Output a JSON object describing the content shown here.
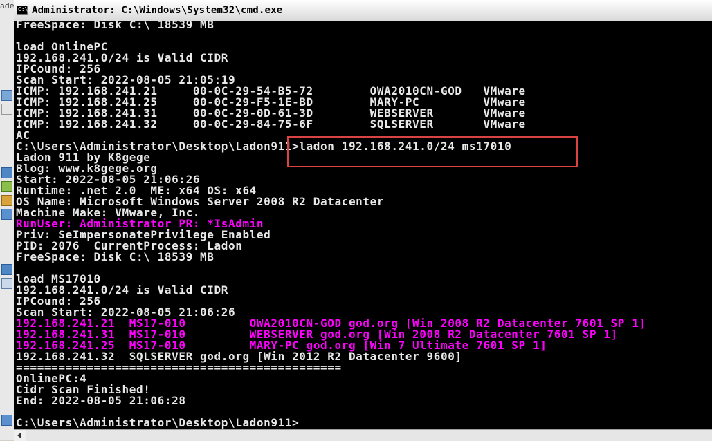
{
  "window": {
    "title": "Administrator: C:\\Windows\\System32\\cmd.exe",
    "icon": "cmd-icon",
    "icon_text": "C:\\."
  },
  "desktop": {
    "partial_text": "ade"
  },
  "console": {
    "lines": [
      {
        "text": "FreeSpace: Disk C:\\ 18539 MB",
        "color": "#e8e8e8"
      },
      {
        "text": "",
        "color": "#e8e8e8"
      },
      {
        "text": "load OnlinePC",
        "color": "#e8e8e8"
      },
      {
        "text": "192.168.241.0/24 is Valid CIDR",
        "color": "#e8e8e8"
      },
      {
        "text": "IPCound: 256",
        "color": "#e8e8e8"
      },
      {
        "text": "Scan Start: 2022-08-05 21:05:19",
        "color": "#e8e8e8"
      },
      {
        "text": "ICMP: 192.168.241.21     00-0C-29-54-B5-72        OWA2010CN-GOD   VMware",
        "color": "#e8e8e8"
      },
      {
        "text": "ICMP: 192.168.241.25     00-0C-29-F5-1E-BD        MARY-PC         VMware",
        "color": "#e8e8e8"
      },
      {
        "text": "ICMP: 192.168.241.31     00-0C-29-0D-61-3D        WEBSERVER       VMware",
        "color": "#e8e8e8"
      },
      {
        "text": "ICMP: 192.168.241.32     00-0C-29-84-75-6F        SQLSERVER       VMware",
        "color": "#e8e8e8"
      },
      {
        "text": "AC",
        "color": "#e8e8e8"
      },
      {
        "text": "C:\\Users\\Administrator\\Desktop\\Ladon911>ladon 192.168.241.0/24 ms17010",
        "color": "#e8e8e8"
      },
      {
        "text": "Ladon 911 by K8gege",
        "color": "#e8e8e8"
      },
      {
        "text": "Blog: www.k8gege.org",
        "color": "#e8e8e8"
      },
      {
        "text": "Start: 2022-08-05 21:06:26",
        "color": "#e8e8e8"
      },
      {
        "text": "Runtime: .net 2.0  ME: x64 OS: x64",
        "color": "#e8e8e8"
      },
      {
        "text": "OS Name: Microsoft Windows Server 2008 R2 Datacenter",
        "color": "#e8e8e8"
      },
      {
        "text": "Machine Make: VMware, Inc.",
        "color": "#e8e8e8"
      },
      {
        "text": "RunUser: Administrator PR: *IsAdmin",
        "color": "#ff00ff"
      },
      {
        "text": "Priv: SeImpersonatePrivilege Enabled",
        "color": "#e8e8e8"
      },
      {
        "text": "PID: 2076  CurrentProcess: Ladon",
        "color": "#e8e8e8"
      },
      {
        "text": "FreeSpace: Disk C:\\ 18539 MB",
        "color": "#e8e8e8"
      },
      {
        "text": "",
        "color": "#e8e8e8"
      },
      {
        "text": "load MS17010",
        "color": "#e8e8e8"
      },
      {
        "text": "192.168.241.0/24 is Valid CIDR",
        "color": "#e8e8e8"
      },
      {
        "text": "IPCound: 256",
        "color": "#e8e8e8"
      },
      {
        "text": "Scan Start: 2022-08-05 21:06:26",
        "color": "#e8e8e8"
      },
      {
        "text": "192.168.241.21  MS17-010         OWA2010CN-GOD god.org [Win 2008 R2 Datacenter 7601 SP 1]",
        "color": "#ff00ff"
      },
      {
        "text": "192.168.241.31  MS17-010         WEBSERVER god.org [Win 2008 R2 Datacenter 7601 SP 1]",
        "color": "#ff00ff"
      },
      {
        "text": "192.168.241.25  MS17-010         MARY-PC god.org [Win 7 Ultimate 7601 SP 1]",
        "color": "#ff00ff"
      },
      {
        "text": "192.168.241.32  SQLSERVER god.org [Win 2012 R2 Datacenter 9600]",
        "color": "#e8e8e8"
      },
      {
        "text": "==============================================",
        "color": "#e8e8e8"
      },
      {
        "text": "OnlinePC:4",
        "color": "#e8e8e8"
      },
      {
        "text": "Cidr Scan Finished!",
        "color": "#e8e8e8"
      },
      {
        "text": "End: 2022-08-05 21:06:28",
        "color": "#e8e8e8"
      },
      {
        "text": "",
        "color": "#e8e8e8"
      },
      {
        "text": "C:\\Users\\Administrator\\Desktop\\Ladon911>",
        "color": "#e8e8e8"
      }
    ]
  },
  "colors": {
    "console_bg": "#000000",
    "console_text": "#e8e8e8",
    "console_magenta": "#ff00ff",
    "highlight_box": "#d94343"
  }
}
